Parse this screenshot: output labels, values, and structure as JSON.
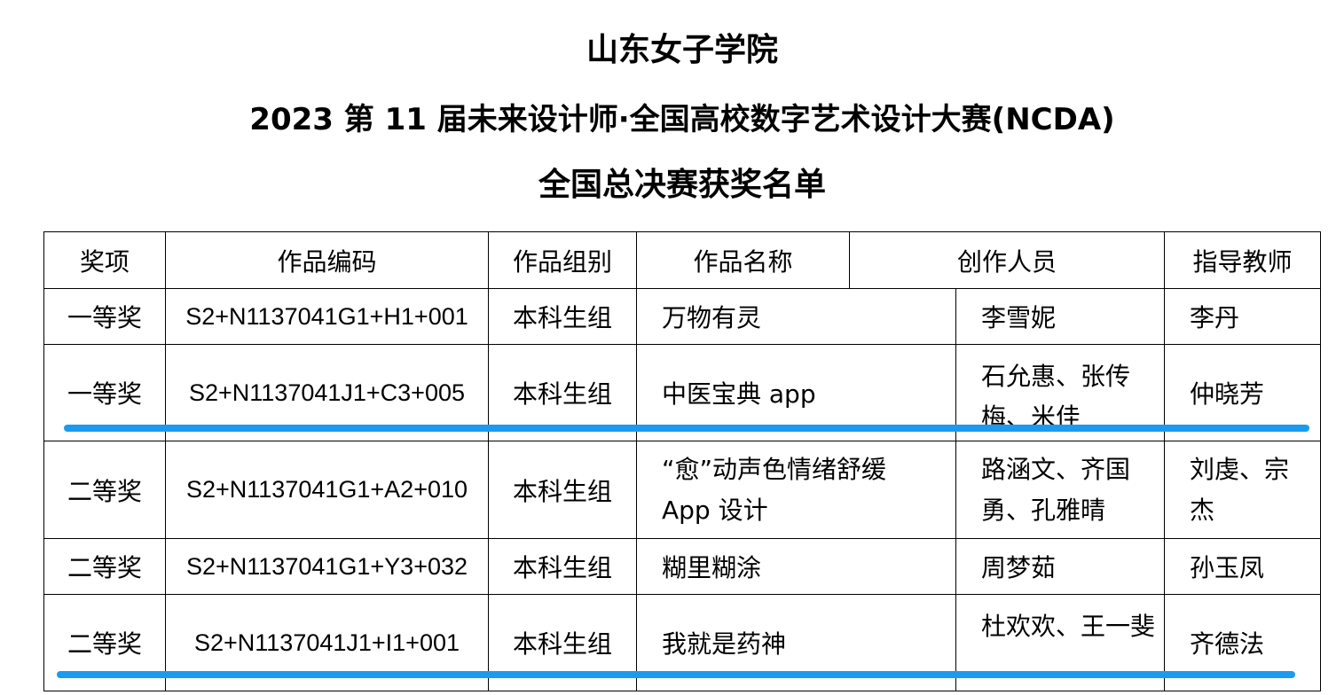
{
  "document": {
    "titles": {
      "school": "山东女子学院",
      "competition": "2023 第 11 届未来设计师·全国高校数字艺术设计大赛(NCDA)",
      "list_name": "全国总决赛获奖名单"
    },
    "table": {
      "headers": [
        "奖项",
        "作品编码",
        "作品组别",
        "作品名称",
        "创作人员",
        "指导教师"
      ],
      "rows": [
        {
          "award": "一等奖",
          "code": "S2+N1137041G1+H1+001",
          "group": "本科生组",
          "title": "万物有灵",
          "creators": "李雪妮",
          "teacher": "李丹"
        },
        {
          "award": "一等奖",
          "code": "S2+N1137041J1+C3+005",
          "group": "本科生组",
          "title": "中医宝典 app",
          "creators": "石允惠、张传梅、米佳",
          "teacher": "仲晓芳"
        },
        {
          "award": "二等奖",
          "code": "S2+N1137041G1+A2+010",
          "group": "本科生组",
          "title": "“愈”动声色情绪舒缓App 设计",
          "creators": "路涵文、齐国勇、孔雅晴",
          "teacher": "刘虔、宗杰"
        },
        {
          "award": "二等奖",
          "code": "S2+N1137041G1+Y3+032",
          "group": "本科生组",
          "title": "糊里糊涂",
          "creators": "周梦茹",
          "teacher": "孙玉凤"
        },
        {
          "award": "二等奖",
          "code": "S2+N1137041J1+I1+001",
          "group": "本科生组",
          "title": "我就是药神",
          "creators": "杜欢欢、王一斐",
          "teacher": "齐德法"
        }
      ]
    }
  },
  "annotations": {
    "highlight_color": "#1a9bf0"
  }
}
